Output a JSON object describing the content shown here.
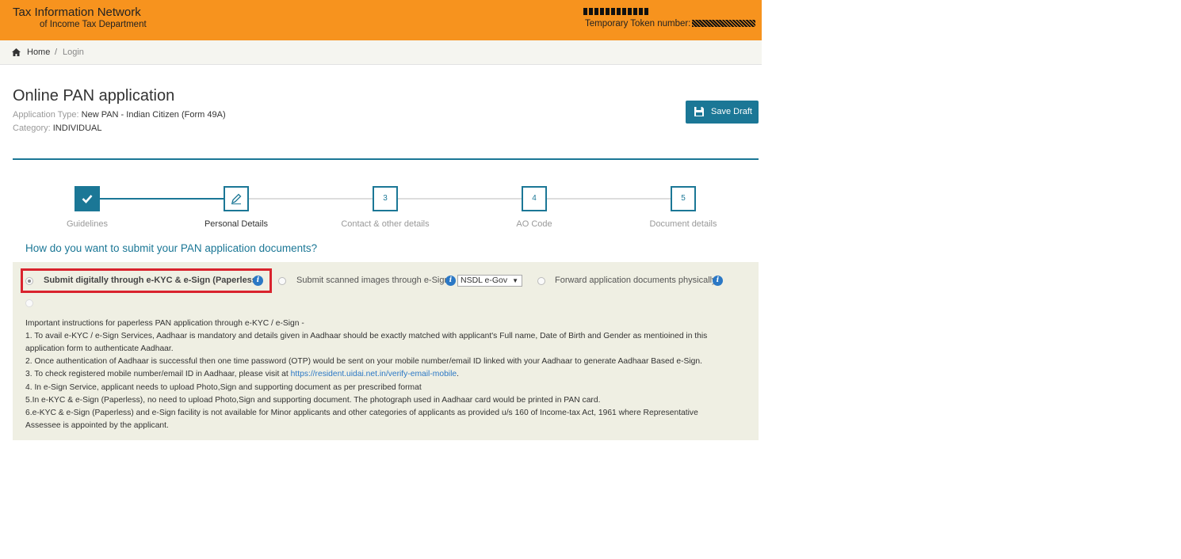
{
  "header": {
    "brand_line1": "Tax Information Network",
    "brand_line2": "of Income Tax Department",
    "token_label": "Temporary Token number:",
    "bg_color": "#f7931e"
  },
  "breadcrumb": {
    "home_icon": "home-icon",
    "home": "Home",
    "separator": "/",
    "current": "Login"
  },
  "page": {
    "title": "Online PAN application",
    "application_type_label": "Application Type: ",
    "application_type_value": "New PAN - Indian Citizen (Form 49A)",
    "category_label": "Category: ",
    "category_value": "INDIVIDUAL",
    "save_draft_label": "Save Draft",
    "accent_color": "#1b7796"
  },
  "stepper": {
    "steps": [
      {
        "label": "Guidelines",
        "number": "",
        "state": "done"
      },
      {
        "label": "Personal Details",
        "number": "",
        "state": "active"
      },
      {
        "label": "Contact & other details",
        "number": "3",
        "state": "pending"
      },
      {
        "label": "AO Code",
        "number": "4",
        "state": "pending"
      },
      {
        "label": "Document details",
        "number": "5",
        "state": "pending"
      }
    ]
  },
  "submission": {
    "question": "How do you want to submit your PAN application documents?",
    "options": [
      {
        "label": "Submit digitally through e-KYC & e-Sign (Paperless)",
        "selected": true
      },
      {
        "label": "Submit scanned images through e-Sign",
        "selected": false
      },
      {
        "label": "Forward application documents physically",
        "selected": false
      }
    ],
    "esign_provider": "NSDL e-Gov",
    "highlight_color": "#d9232d"
  },
  "instructions": {
    "heading": "Important instructions for paperless PAN application through e-KYC / e-Sign -",
    "line1a": "1. To avail e-KYC / e-Sign Services, Aadhaar is mandatory and details given in Aadhaar should be exactly matched with applicant's Full name, Date of Birth and Gender as mentioined in this",
    "line1b": "application form to authenticate Aadhaar.",
    "line2": "2. Once authentication of Aadhaar is successful then one time password (OTP) would be sent on your mobile number/email ID linked with your Aadhaar to generate Aadhaar Based e-Sign.",
    "line3_prefix": "3. To check registered mobile number/email ID in Aadhaar, please visit at ",
    "line3_link": "https://resident.uidai.net.in/verify-email-mobile",
    "line3_suffix": ".",
    "line4": "4. In e-Sign Service, applicant needs to upload Photo,Sign and supporting document as per prescribed format",
    "line5": "5.In e-KYC & e-Sign (Paperless), no need to upload Photo,Sign and supporting document. The photograph used in Aadhaar card would be printed in PAN card.",
    "line6a": "6.e-KYC & e-Sign (Paperless) and e-Sign facility is not available for Minor applicants and other categories of applicants as provided u/s 160 of Income-tax Act, 1961 where Representative",
    "line6b": "Assessee is appointed by the applicant."
  }
}
